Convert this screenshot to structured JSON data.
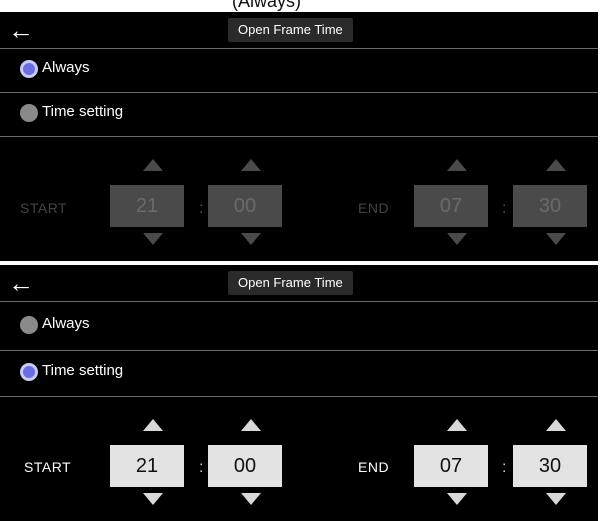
{
  "top_caption": "(Always)",
  "panels": [
    {
      "back_icon": "left-arrow-icon",
      "title": "Open Frame Time",
      "options": [
        {
          "label": "Always",
          "selected": true
        },
        {
          "label": "Time setting",
          "selected": false
        }
      ],
      "timer_enabled": false,
      "start": {
        "label": "START",
        "hour": "21",
        "minute": "00"
      },
      "end": {
        "label": "END",
        "hour": "07",
        "minute": "30"
      },
      "separator": ":"
    },
    {
      "back_icon": "left-arrow-icon",
      "title": "Open Frame Time",
      "options": [
        {
          "label": "Always",
          "selected": false
        },
        {
          "label": "Time setting",
          "selected": true
        }
      ],
      "timer_enabled": true,
      "start": {
        "label": "START",
        "hour": "21",
        "minute": "00"
      },
      "end": {
        "label": "END",
        "hour": "07",
        "minute": "30"
      },
      "separator": ":"
    }
  ],
  "colors": {
    "background": "#000000",
    "selected_radio": "#6b6ee0",
    "unselected_radio": "#8a8a8a",
    "enabled_box": "#e3e3e3",
    "disabled_box": "#4a4a4a"
  }
}
